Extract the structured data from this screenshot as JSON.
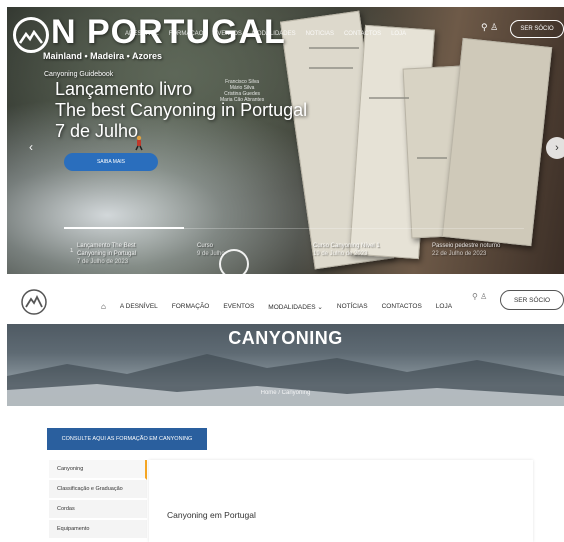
{
  "hero": {
    "brand": "N PORTUGAL",
    "region": "Mainland • Madeira • Azores",
    "nav_items": [
      "ADESNÍVEL",
      "FORMAÇÃO",
      "EVENTOS",
      "MODALIDADES",
      "NOTÍCIAS",
      "CONTACTOS",
      "LOJA"
    ],
    "user_icons": "⚲ ♙",
    "ser_socio": "SER SÓCIO",
    "guidebook": "Canyoning Guidebook",
    "title_lines": [
      "Lançamento livro",
      "The best Canyoning in Portugal",
      "7 de Julho"
    ],
    "credits": [
      "Francisco Silva",
      "Mário Silva",
      "Cristina Guedes",
      "Maria Cão Abrantes"
    ],
    "cta": "SAIBA MAIS",
    "prev": "‹",
    "next": "›",
    "progress_fraction": 0.26,
    "slide_number": "1",
    "slides": [
      {
        "title": "Lançamento The Best",
        "title2": "Canyoning in Portugal",
        "date": "7 de Julho de 2023"
      },
      {
        "title": "Curso",
        "title2": "",
        "date": "9 de Julho"
      },
      {
        "title": "Curso Canyoning Nível 1",
        "title2": "",
        "date": "19 de Julho de 2023"
      },
      {
        "title": "Passeio pedestre noturno",
        "title2": "",
        "date": "22 de Julho de 2023"
      }
    ]
  },
  "nav": {
    "home_icon": "⌂",
    "links": [
      "A DESNÍVEL",
      "FORMAÇÃO",
      "EVENTOS",
      "MODALIDADES ⌄",
      "NOTÍCIAS",
      "CONTACTOS",
      "LOJA"
    ],
    "user_icons": "⚲ ♙",
    "ser_socio": "SER SÓCIO"
  },
  "banner": {
    "title": "CANYONING",
    "breadcrumb": "Home  /  Canyoning"
  },
  "content": {
    "consulte": "CONSULTE AQUI AS FORMAÇÃO EM CANYONING",
    "side_menu": [
      "Canyoning",
      "Classificação e Graduação",
      "Cordas",
      "Equipamento"
    ],
    "panel_title": "Canyoning em Portugal"
  },
  "colors": {
    "accent_blue": "#2a5f9e",
    "active_marker": "#f5a623"
  }
}
